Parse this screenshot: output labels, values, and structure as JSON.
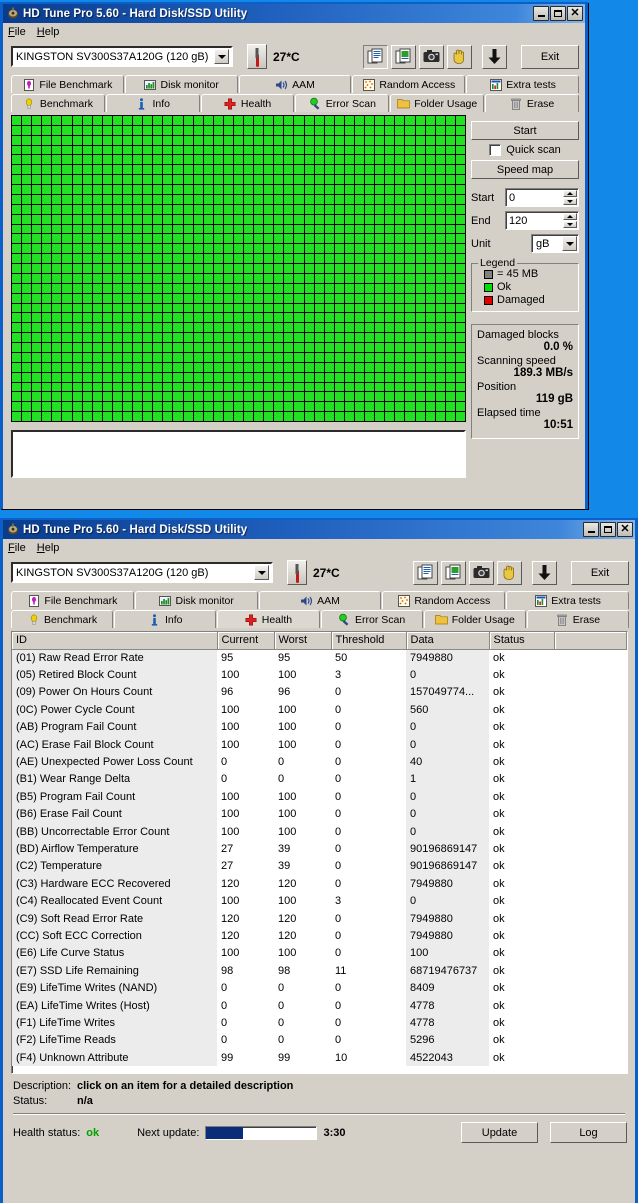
{
  "window1": {
    "title": "HD Tune Pro 5.60 - Hard Disk/SSD Utility",
    "menu": [
      "File",
      "Help"
    ],
    "drive": "KINGSTON SV300S37A120G (120 gB)",
    "temperature": "27*C",
    "exit_label": "Exit",
    "tabs_top": [
      "File Benchmark",
      "Disk monitor",
      "AAM",
      "Random Access",
      "Extra tests"
    ],
    "tabs_bottom": [
      "Benchmark",
      "Info",
      "Health",
      "Error Scan",
      "Folder Usage",
      "Erase"
    ],
    "active_tab": "Error Scan",
    "controls": {
      "start_button": "Start",
      "quick_scan": "Quick scan",
      "speed_map": "Speed map",
      "start_label": "Start",
      "start_value": "0",
      "end_label": "End",
      "end_value": "120",
      "unit_label": "Unit",
      "unit_value": "gB"
    },
    "legend": {
      "title": "Legend",
      "block_size": "= 45 MB",
      "ok": "Ok",
      "damaged": "Damaged",
      "color_block": "#808080",
      "color_ok": "#00e000",
      "color_damaged": "#e00000"
    },
    "stats": [
      {
        "label": "Damaged blocks",
        "value": "0.0 %"
      },
      {
        "label": "Scanning speed",
        "value": "189.3 MB/s"
      },
      {
        "label": "Position",
        "value": "119 gB"
      },
      {
        "label": "Elapsed time",
        "value": "10:51"
      }
    ]
  },
  "window2": {
    "title": "HD Tune Pro 5.60 - Hard Disk/SSD Utility",
    "menu": [
      "File",
      "Help"
    ],
    "drive": "KINGSTON SV300S37A120G (120 gB)",
    "temperature": "27*C",
    "exit_label": "Exit",
    "tabs_top": [
      "File Benchmark",
      "Disk monitor",
      "AAM",
      "Random Access",
      "Extra tests"
    ],
    "tabs_bottom": [
      "Benchmark",
      "Info",
      "Health",
      "Error Scan",
      "Folder Usage",
      "Erase"
    ],
    "active_tab": "Health",
    "table": {
      "columns": [
        "ID",
        "Current",
        "Worst",
        "Threshold",
        "Data",
        "Status",
        ""
      ],
      "rows": [
        [
          "(01) Raw Read Error Rate",
          "95",
          "95",
          "50",
          "7949880",
          "ok"
        ],
        [
          "(05) Retired Block Count",
          "100",
          "100",
          "3",
          "0",
          "ok"
        ],
        [
          "(09) Power On Hours Count",
          "96",
          "96",
          "0",
          "157049774...",
          "ok"
        ],
        [
          "(0C) Power Cycle Count",
          "100",
          "100",
          "0",
          "560",
          "ok"
        ],
        [
          "(AB) Program Fail Count",
          "100",
          "100",
          "0",
          "0",
          "ok"
        ],
        [
          "(AC) Erase Fail Block Count",
          "100",
          "100",
          "0",
          "0",
          "ok"
        ],
        [
          "(AE) Unexpected Power Loss Count",
          "0",
          "0",
          "0",
          "40",
          "ok"
        ],
        [
          "(B1) Wear Range Delta",
          "0",
          "0",
          "0",
          "1",
          "ok"
        ],
        [
          "(B5) Program Fail Count",
          "100",
          "100",
          "0",
          "0",
          "ok"
        ],
        [
          "(B6) Erase Fail Count",
          "100",
          "100",
          "0",
          "0",
          "ok"
        ],
        [
          "(BB) Uncorrectable Error Count",
          "100",
          "100",
          "0",
          "0",
          "ok"
        ],
        [
          "(BD) Airflow Temperature",
          "27",
          "39",
          "0",
          "90196869147",
          "ok"
        ],
        [
          "(C2) Temperature",
          "27",
          "39",
          "0",
          "90196869147",
          "ok"
        ],
        [
          "(C3) Hardware ECC Recovered",
          "120",
          "120",
          "0",
          "7949880",
          "ok"
        ],
        [
          "(C4) Reallocated Event Count",
          "100",
          "100",
          "3",
          "0",
          "ok"
        ],
        [
          "(C9) Soft Read Error Rate",
          "120",
          "120",
          "0",
          "7949880",
          "ok"
        ],
        [
          "(CC) Soft ECC Correction",
          "120",
          "120",
          "0",
          "7949880",
          "ok"
        ],
        [
          "(E6) Life Curve Status",
          "100",
          "100",
          "0",
          "100",
          "ok"
        ],
        [
          "(E7) SSD Life Remaining",
          "98",
          "98",
          "11",
          "68719476737",
          "ok"
        ],
        [
          "(E9) LifeTime Writes (NAND)",
          "0",
          "0",
          "0",
          "8409",
          "ok"
        ],
        [
          "(EA) LifeTime Writes (Host)",
          "0",
          "0",
          "0",
          "4778",
          "ok"
        ],
        [
          "(F1) LifeTime Writes",
          "0",
          "0",
          "0",
          "4778",
          "ok"
        ],
        [
          "(F2) LifeTime Reads",
          "0",
          "0",
          "0",
          "5296",
          "ok"
        ],
        [
          "(F4) Unknown Attribute",
          "99",
          "99",
          "10",
          "4522043",
          "ok"
        ]
      ]
    },
    "details": {
      "description_label": "Description:",
      "description_value": "click on an item for a detailed description",
      "status_label": "Status:",
      "status_value": "n/a"
    },
    "footer": {
      "health_label": "Health status:",
      "health_value": "ok",
      "health_color": "#00a000",
      "next_update_label": "Next update:",
      "progress_percent": 33,
      "progress_color": "#0a2d7a",
      "countdown": "3:30",
      "update_button": "Update",
      "log_button": "Log"
    }
  },
  "icons": {
    "minimize": "minimize-icon",
    "maximize": "maximize-icon",
    "close": "close-icon"
  }
}
